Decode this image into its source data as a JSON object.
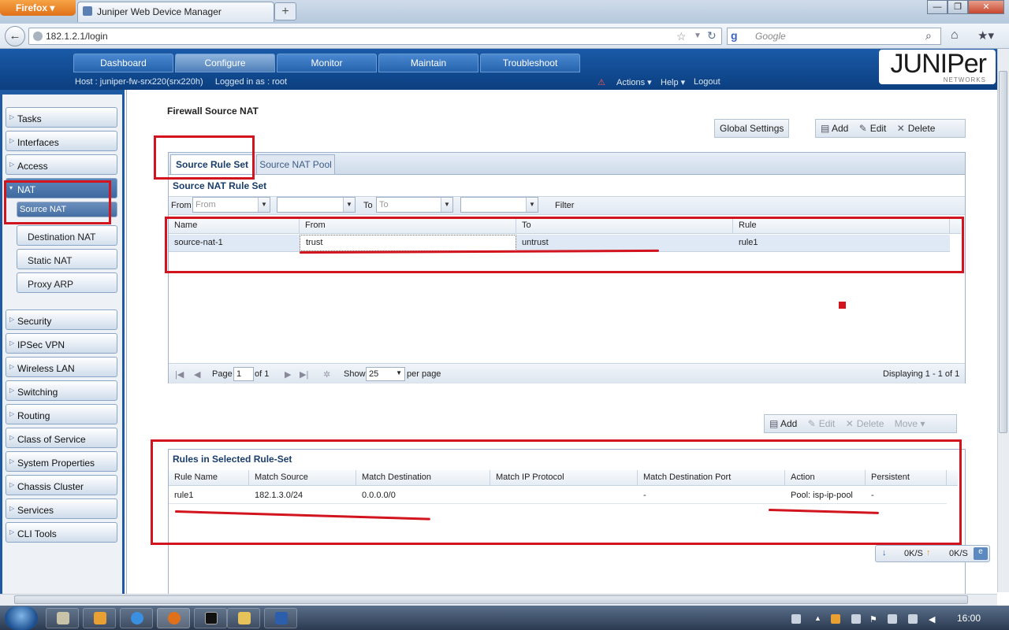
{
  "browser": {
    "menu_label": "Firefox",
    "tab_title": "Juniper Web Device Manager",
    "url": "182.1.2.1/login",
    "search_placeholder": "Google"
  },
  "app": {
    "nav_tabs": [
      "Dashboard",
      "Configure",
      "Monitor",
      "Maintain",
      "Troubleshoot"
    ],
    "active_tab": "Configure",
    "host_text": "Host : juniper-fw-srx220(srx220h)",
    "logged_in_text": "Logged in as : root",
    "actions_label": "Actions",
    "help_label": "Help",
    "logout_label": "Logout",
    "logo_text": "JUNIPer",
    "logo_sub": "NETWORKS"
  },
  "sidebar": {
    "items": [
      "Tasks",
      "Interfaces",
      "Access",
      "NAT"
    ],
    "nat_subitems": [
      "Source NAT",
      "Destination NAT",
      "Static NAT",
      "Proxy ARP"
    ],
    "items_after": [
      "Security",
      "IPSec VPN",
      "Wireless LAN",
      "Switching",
      "Routing",
      "Class of Service",
      "System Properties",
      "Chassis Cluster",
      "Services",
      "CLI Tools"
    ]
  },
  "main": {
    "page_title": "Firewall Source NAT",
    "global_settings": "Global Settings",
    "add": "Add",
    "edit": "Edit",
    "delete": "Delete",
    "move": "Move",
    "tabs": [
      "Source Rule Set",
      "Source NAT Pool"
    ],
    "ruleset_title": "Source NAT Rule Set",
    "filter": {
      "from_label": "From",
      "from_placeholder": "From",
      "to_label": "To",
      "to_placeholder": "To",
      "filter_label": "Filter"
    },
    "ruleset_columns": [
      "Name",
      "From",
      "To",
      "Rule"
    ],
    "ruleset_rows": [
      {
        "name": "source-nat-1",
        "from": "trust",
        "to": "untrust",
        "rule": "rule1"
      }
    ],
    "pager": {
      "page_label": "Page",
      "page_value": "1",
      "of_label": "of 1",
      "show_label": "Show",
      "show_value": "25",
      "per_page": "per page",
      "displaying": "Displaying 1 - 1 of 1"
    },
    "rules_title": "Rules in Selected Rule-Set",
    "rules_columns": [
      "Rule Name",
      "Match Source",
      "Match Destination",
      "Match IP Protocol",
      "Match Destination Port",
      "Action",
      "Persistent"
    ],
    "rules_rows": [
      {
        "rule_name": "rule1",
        "match_source": "182.1.3.0/24",
        "match_destination": "0.0.0.0/0",
        "match_ip_protocol": "",
        "match_destination_port": "-",
        "action": "Pool: isp-ip-pool",
        "persistent": "-"
      }
    ]
  },
  "status": {
    "down_rate": "0K/S",
    "up_rate": "0K/S"
  },
  "taskbar": {
    "clock": "16:00"
  },
  "colors": {
    "annotation_red": "#d2141e",
    "header_blue": "#0b3f80"
  }
}
